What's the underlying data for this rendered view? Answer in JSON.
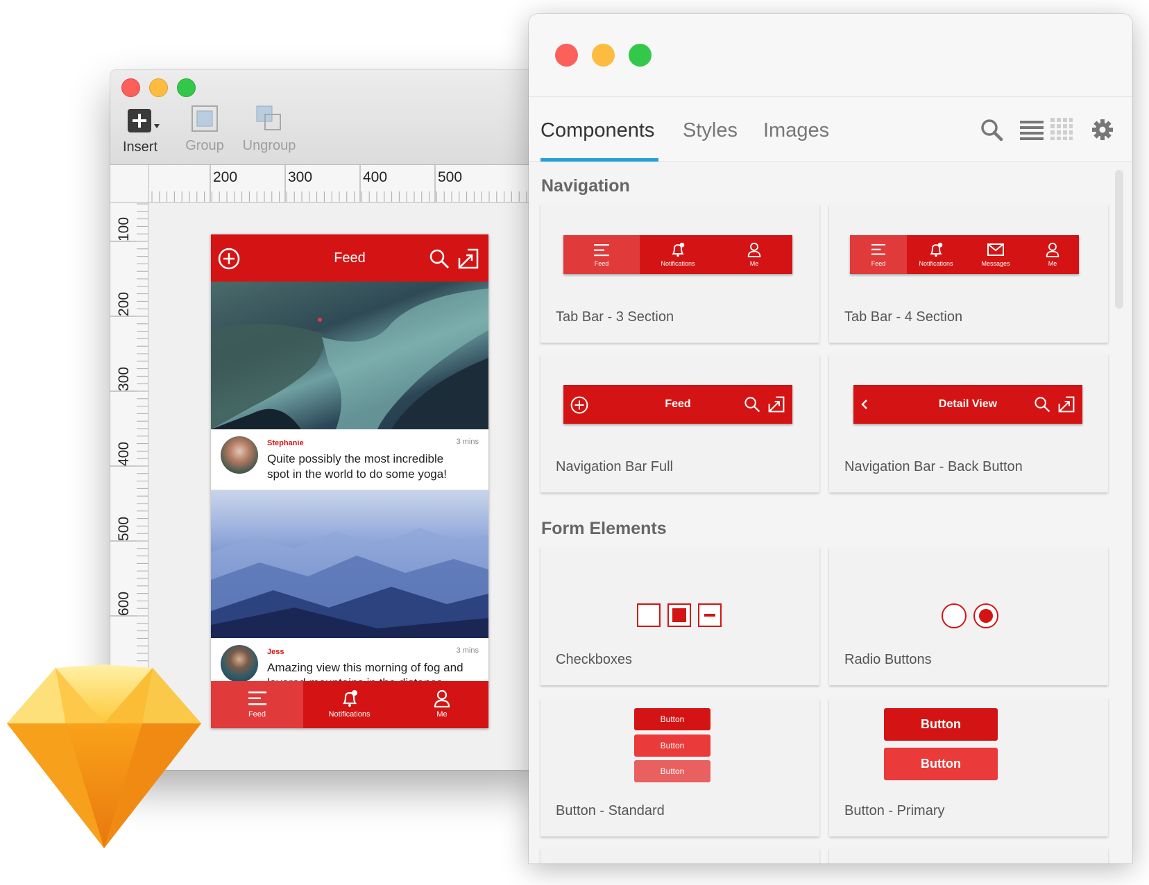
{
  "colors": {
    "brand_red": "#d41414",
    "accent_blue": "#2a9fd6",
    "mac_red": "#fc605b",
    "mac_yellow": "#fdbc40",
    "mac_green": "#34c84a"
  },
  "sketch": {
    "toolbar": {
      "insert_label": "Insert",
      "group_label": "Group",
      "ungroup_label": "Ungroup"
    },
    "ruler": {
      "top": [
        "200",
        "300",
        "400",
        "500"
      ],
      "left": [
        "100",
        "200",
        "300",
        "400",
        "500",
        "600"
      ]
    }
  },
  "phone": {
    "nav_title": "Feed",
    "posts": [
      {
        "name": "Stephanie",
        "time": "3 mins",
        "text_line1": "Quite possibly the most incredible",
        "text_line2": "spot in the world to do some yoga!"
      },
      {
        "name": "Jess",
        "time": "3 mins",
        "text_line1": "Amazing view this morning of fog and",
        "text_line2": "layered mountains in the distance"
      }
    ],
    "tabs": [
      {
        "label": "Feed",
        "icon": "menu-icon"
      },
      {
        "label": "Notifications",
        "icon": "bell-icon"
      },
      {
        "label": "Me",
        "icon": "person-icon"
      }
    ]
  },
  "panel": {
    "tabs": [
      "Components",
      "Styles",
      "Images"
    ],
    "active_tab": "Components",
    "sections": [
      {
        "title": "Navigation",
        "cards": [
          {
            "label": "Tab Bar - 3 Section",
            "tabs": [
              "Feed",
              "Notifications",
              "Me"
            ]
          },
          {
            "label": "Tab Bar - 4 Section",
            "tabs": [
              "Feed",
              "Notifications",
              "Messages",
              "Me"
            ]
          },
          {
            "label": "Navigation Bar Full",
            "bar_title": "Feed"
          },
          {
            "label": "Navigation Bar - Back Button",
            "bar_title": "Detail View"
          }
        ]
      },
      {
        "title": "Form Elements",
        "cards": [
          {
            "label": "Checkboxes"
          },
          {
            "label": "Radio Buttons"
          },
          {
            "label": "Button - Standard",
            "buttons": [
              "Button",
              "Button",
              "Button"
            ]
          },
          {
            "label": "Button - Primary",
            "buttons": [
              "Button",
              "Button"
            ]
          }
        ]
      }
    ]
  }
}
